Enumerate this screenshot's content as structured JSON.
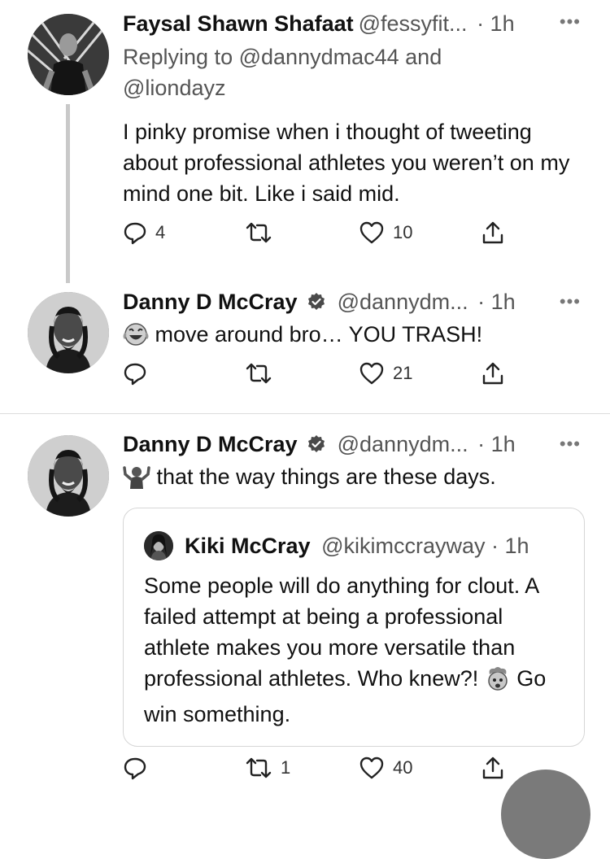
{
  "tweets": [
    {
      "name": "Faysal Shawn Shafaat",
      "handle": "@fessyfit...",
      "time": "· 1h",
      "reply_prefix": "Replying to",
      "reply_user1": "@dannydmac44",
      "reply_and": "and",
      "reply_user2": "@liondayz",
      "text": "I pinky promise when i thought of tweeting about professional athletes you weren’t on my mind one bit. Like i said mid.",
      "replies": "4",
      "retweets": "",
      "likes": "10"
    },
    {
      "name": "Danny D McCray",
      "handle": "@dannydm...",
      "time": "· 1h",
      "emoji": "laughing-crying",
      "text": "move around bro… YOU TRASH!",
      "replies": "",
      "retweets": "",
      "likes": "21"
    },
    {
      "name": "Danny D McCray",
      "handle": "@dannydm...",
      "time": "· 1h",
      "emoji": "shrug",
      "text": "that the way things are these days.",
      "quote": {
        "name": "Kiki McCray",
        "handle": "@kikimccrayway",
        "time": "· 1h",
        "text_part1": "Some people will do anything for clout. A failed attempt at being a professional athlete makes you more versatile than professional athletes. Who knew?!",
        "emoji": "exploding-head",
        "text_part2": "Go win something."
      },
      "replies": "",
      "retweets": "1",
      "likes": "40"
    }
  ],
  "more_label": "•••",
  "colors": {
    "text": "#111111",
    "secondary": "#555555",
    "divider": "#dcdcdc",
    "thread_line": "#c9c9c9"
  }
}
